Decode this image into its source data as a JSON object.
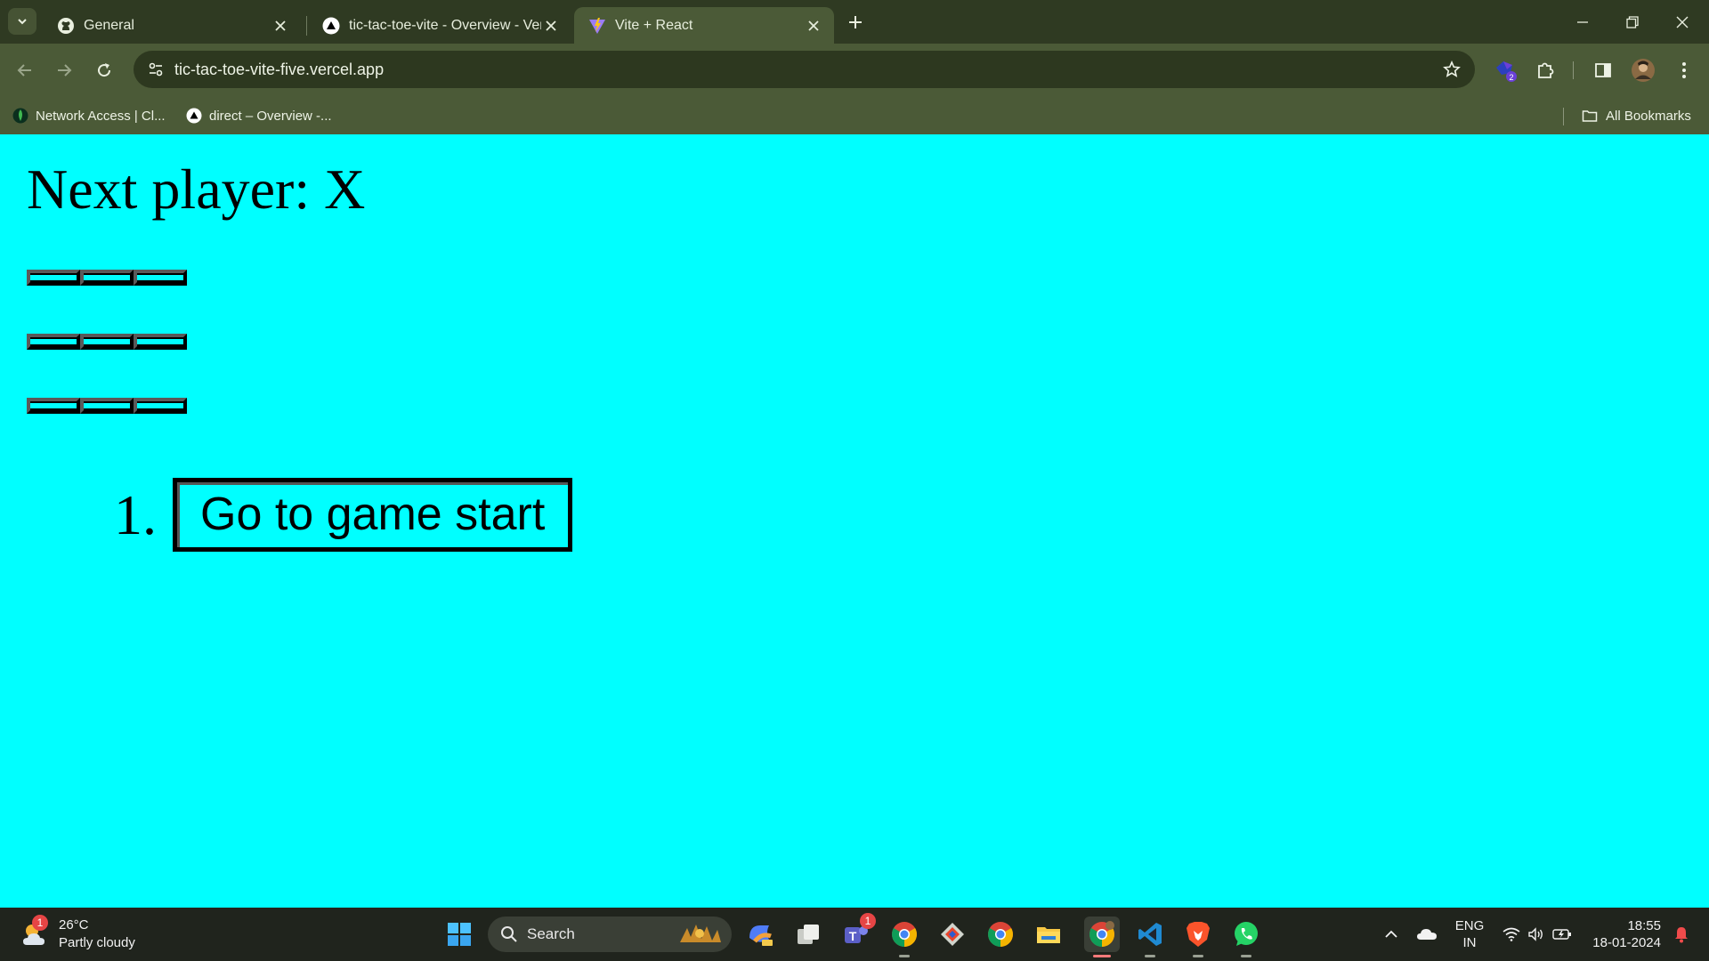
{
  "browser": {
    "tabs": [
      {
        "title": "General",
        "favicon": "github-icon",
        "active": false
      },
      {
        "title": "tic-tac-toe-vite - Overview - Ver",
        "favicon": "vercel-icon",
        "active": false
      },
      {
        "title": "Vite + React",
        "favicon": "vite-icon",
        "active": true
      }
    ],
    "url": "tic-tac-toe-vite-five.vercel.app",
    "bookmarks": [
      {
        "label": "Network Access | Cl...",
        "icon": "mongodb-leaf-icon"
      },
      {
        "label": "direct – Overview -...",
        "icon": "vercel-icon"
      }
    ],
    "all_bookmarks_label": "All Bookmarks",
    "extension_badge": "2"
  },
  "game": {
    "status": "Next player: X",
    "board": [
      [
        "",
        "",
        ""
      ],
      [
        "",
        "",
        ""
      ],
      [
        "",
        "",
        ""
      ]
    ],
    "moves": [
      {
        "number": "1.",
        "label": "Go to game start"
      }
    ]
  },
  "taskbar": {
    "weather": {
      "temp": "26°C",
      "condition": "Partly cloudy",
      "badge": "1"
    },
    "search_label": "Search",
    "teams_badge": "1",
    "language": {
      "line1": "ENG",
      "line2": "IN"
    },
    "clock": {
      "time": "18:55",
      "date": "18-01-2024"
    }
  },
  "colors": {
    "page_background": "#00ffff",
    "browser_frame": "#4b5a37",
    "tabstrip": "#2f3a22"
  }
}
